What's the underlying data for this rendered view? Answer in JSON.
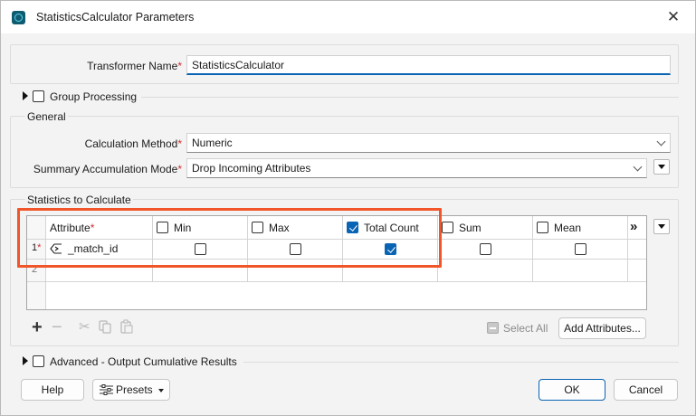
{
  "window": {
    "title": "StatisticsCalculator Parameters"
  },
  "transformer_name": {
    "label": "Transformer Name",
    "required_mark": "*",
    "value": "StatisticsCalculator"
  },
  "group_processing": {
    "label": "Group Processing",
    "checked": false
  },
  "general": {
    "title": "General",
    "calculation_method": {
      "label": "Calculation Method",
      "required_mark": "*",
      "value": "Numeric"
    },
    "summary_mode": {
      "label": "Summary Accumulation Mode",
      "required_mark": "*",
      "value": "Drop Incoming Attributes"
    }
  },
  "statistics": {
    "title": "Statistics to Calculate",
    "attribute_header": "Attribute",
    "required_mark": "*",
    "columns": [
      {
        "label": "Min",
        "header_checked": false
      },
      {
        "label": "Max",
        "header_checked": false
      },
      {
        "label": "Total Count",
        "header_checked": true
      },
      {
        "label": "Sum",
        "header_checked": false
      },
      {
        "label": "Mean",
        "header_checked": false
      }
    ],
    "more_columns": "»",
    "rows": [
      {
        "number": "1",
        "required_mark": "*",
        "attribute": "_match_id",
        "values": [
          false,
          false,
          true,
          false,
          false
        ]
      },
      {
        "number": "2",
        "attribute": "",
        "values": []
      }
    ],
    "select_all": "Select All",
    "add_attributes": "Add Attributes..."
  },
  "advanced": {
    "label": "Advanced - Output Cumulative Results",
    "checked": false
  },
  "footer": {
    "help": "Help",
    "presets": "Presets",
    "ok": "OK",
    "cancel": "Cancel"
  },
  "colors": {
    "accent": "#0a64b4",
    "highlight": "#f0562a",
    "required": "#d42d2d"
  }
}
